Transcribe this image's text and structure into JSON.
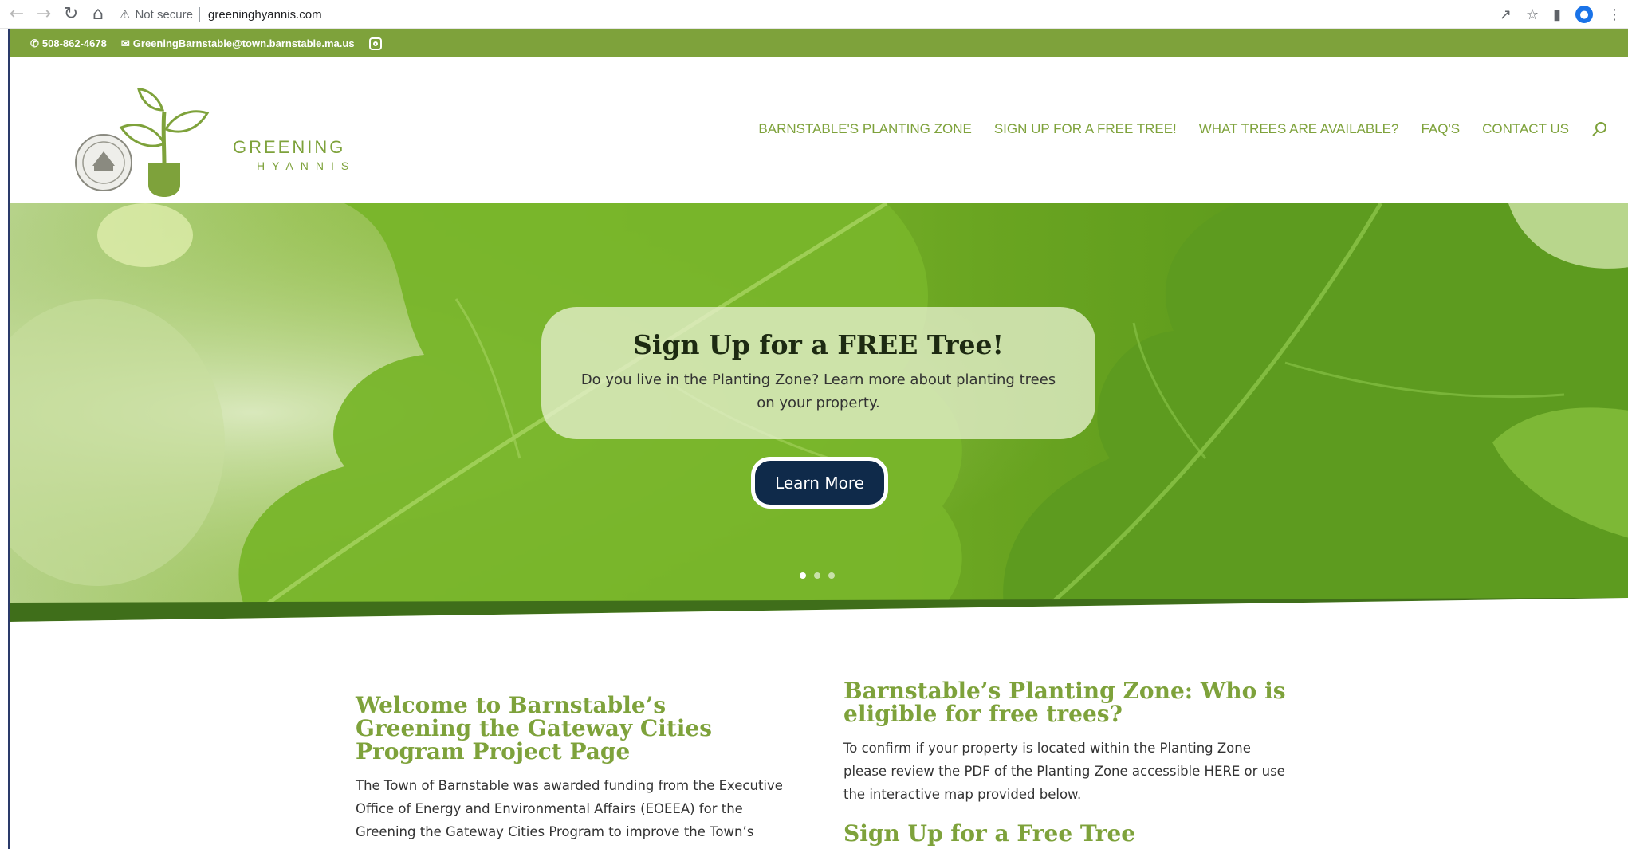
{
  "browser": {
    "security_label": "Not secure",
    "url": "greeninghyannis.com"
  },
  "topbar": {
    "phone": "508-862-4678",
    "email": "GreeningBarnstable@town.barnstable.ma.us"
  },
  "logo": {
    "line1": "GREENING",
    "line2": "HYANNIS"
  },
  "nav": {
    "items": [
      {
        "label": "BARNSTABLE'S PLANTING ZONE"
      },
      {
        "label": "SIGN UP FOR A FREE TREE!"
      },
      {
        "label": "WHAT TREES ARE AVAILABLE?"
      },
      {
        "label": "FAQ'S"
      },
      {
        "label": "CONTACT US"
      }
    ]
  },
  "hero": {
    "title": "Sign Up for a FREE Tree!",
    "subtitle": "Do you live in the Planting Zone?  Learn more about planting trees on your property.",
    "button_label": "Learn More",
    "slides_count": 3,
    "active_slide": 1
  },
  "content": {
    "welcome_heading": "Welcome to Barnstable’s Greening the Gateway Cities Program Project Page",
    "welcome_body": "The Town of Barnstable was awarded funding from the Executive Office of Energy and Environmental Affairs (EOEEA) for the Greening the Gateway Cities Program to improve the Town’s",
    "zone_heading": "Barnstable’s Planting Zone: Who is eligible for free trees?",
    "zone_body": "To confirm if your property is located within the Planting Zone please review the PDF of the Planting Zone accessible HERE or use the interactive map provided below.",
    "signup_heading": "Sign Up for a Free Tree"
  },
  "colors": {
    "brand_green": "#7ea23b",
    "button_navy": "#0f2a4a"
  }
}
